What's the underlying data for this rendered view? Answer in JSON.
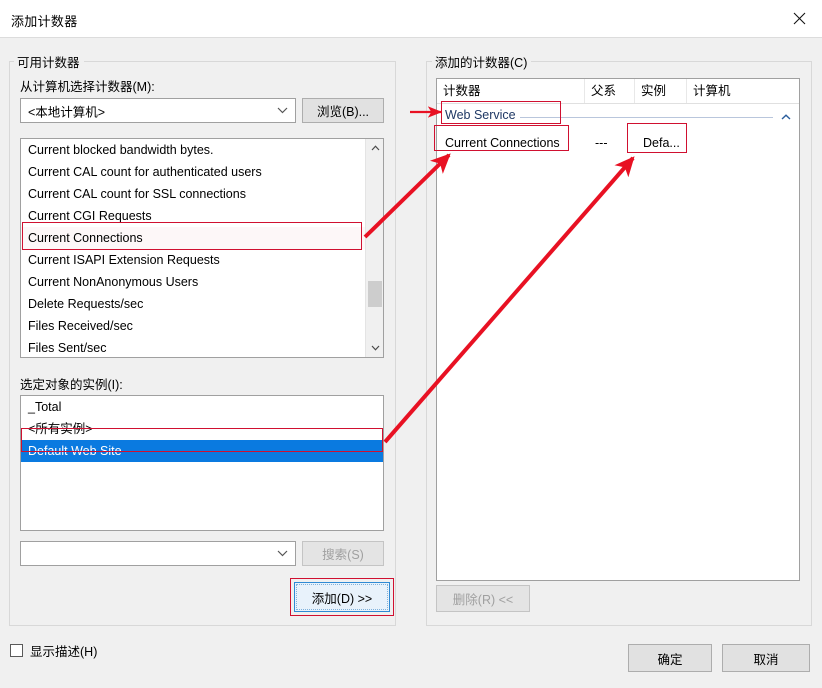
{
  "window": {
    "title": "添加计数器",
    "close_icon": "close-icon"
  },
  "available_counters": {
    "legend": "可用计数器",
    "select_computer_label": "从计算机选择计数器(M):",
    "computer_combo_value": "<本地计算机>",
    "browse_button": "浏览(B)...",
    "counters": [
      {
        "label": "Current blocked bandwidth bytes.",
        "state": "normal"
      },
      {
        "label": "Current CAL count for authenticated users",
        "state": "normal"
      },
      {
        "label": "Current CAL count for SSL connections",
        "state": "normal"
      },
      {
        "label": "Current CGI Requests",
        "state": "normal"
      },
      {
        "label": "Current Connections",
        "state": "annotated"
      },
      {
        "label": "Current ISAPI Extension Requests",
        "state": "normal"
      },
      {
        "label": "Current NonAnonymous Users",
        "state": "normal"
      },
      {
        "label": "Delete Requests/sec",
        "state": "normal"
      },
      {
        "label": "Files Received/sec",
        "state": "normal"
      },
      {
        "label": "Files Sent/sec",
        "state": "normal"
      }
    ],
    "instances_label": "选定对象的实例(I):",
    "instances": [
      {
        "label": "_Total",
        "selected": false
      },
      {
        "label": "<所有实例>",
        "selected": false
      },
      {
        "label": "Default Web Site",
        "selected": true
      }
    ],
    "search_combo_value": "",
    "search_button": "搜索(S)",
    "add_button": "添加(D) >>"
  },
  "added_counters": {
    "legend": "添加的计数器(C)",
    "columns": [
      "计数器",
      "父系",
      "实例",
      "计算机"
    ],
    "group_label": "Web Service",
    "collapse_icon": "chevron-up-icon",
    "rows": [
      {
        "counter": "Current Connections",
        "parent": "---",
        "instance": "Defa...",
        "computer": ""
      }
    ],
    "delete_button": "删除(R) <<"
  },
  "footer": {
    "show_description_label": "显示描述(H)",
    "show_description_checked": false,
    "ok_button": "确定",
    "cancel_button": "取消"
  },
  "colors": {
    "annotation": "#d01030",
    "selection": "#0a7ae0",
    "group_label": "#1f3864",
    "dialog_bg": "#f0f0f0"
  }
}
